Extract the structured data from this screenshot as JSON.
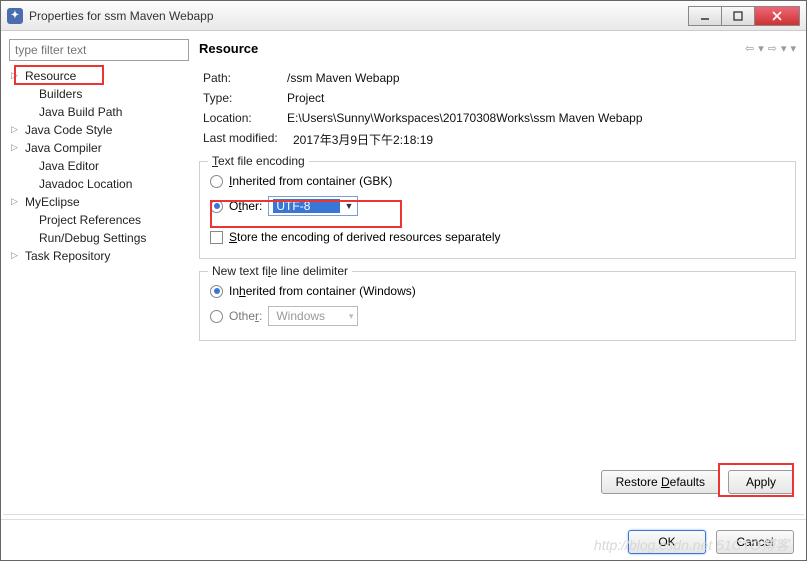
{
  "window": {
    "title": "Properties for ssm Maven Webapp"
  },
  "sidebar": {
    "filter_placeholder": "type filter text",
    "items": [
      {
        "label": "Resource",
        "children": true,
        "indent": false
      },
      {
        "label": "Builders",
        "children": false,
        "indent": true
      },
      {
        "label": "Java Build Path",
        "children": false,
        "indent": true
      },
      {
        "label": "Java Code Style",
        "children": true,
        "indent": false
      },
      {
        "label": "Java Compiler",
        "children": true,
        "indent": false
      },
      {
        "label": "Java Editor",
        "children": false,
        "indent": true
      },
      {
        "label": "Javadoc Location",
        "children": false,
        "indent": true
      },
      {
        "label": "MyEclipse",
        "children": true,
        "indent": false
      },
      {
        "label": "Project References",
        "children": false,
        "indent": true
      },
      {
        "label": "Run/Debug Settings",
        "children": false,
        "indent": true
      },
      {
        "label": "Task Repository",
        "children": true,
        "indent": false
      }
    ]
  },
  "header": {
    "title": "Resource"
  },
  "props": {
    "path_label": "Path:",
    "path_val": "/ssm Maven Webapp",
    "type_label": "Type:",
    "type_val": "Project",
    "loc_label": "Location:",
    "loc_val": "E:\\Users\\Sunny\\Workspaces\\20170308Works\\ssm Maven Webapp",
    "mod_label": "Last modified:",
    "mod_val": "2017年3月9日下午2:18:19"
  },
  "encoding": {
    "legend": "Text file encoding",
    "inherited_label": "Inherited from container (GBK)",
    "other_label": "Other:",
    "other_value": "UTF-8",
    "store_label": "Store the encoding of derived resources separately"
  },
  "delimiter": {
    "legend": "New text file line delimiter",
    "inherited_label": "Inherited from container (Windows)",
    "other_label": "Other:",
    "other_value": "Windows"
  },
  "buttons": {
    "restore": "Restore Defaults",
    "apply": "Apply",
    "ok": "OK",
    "cancel": "Cancel"
  },
  "watermark": "http://blog.csdn.net 51CTO博客"
}
